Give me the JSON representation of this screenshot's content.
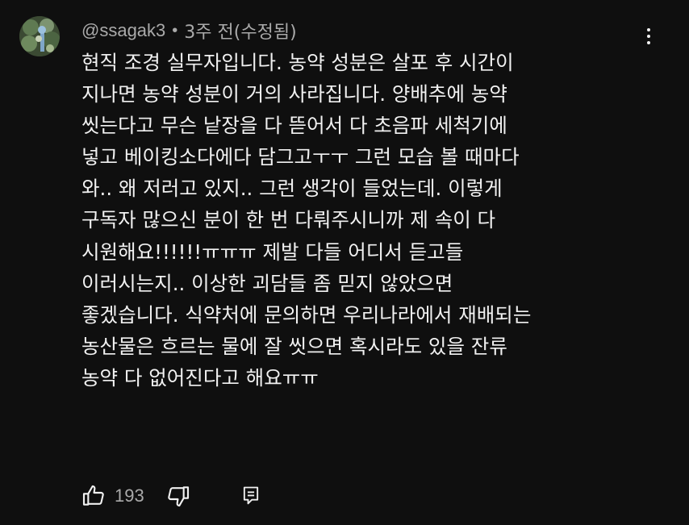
{
  "comment": {
    "author": "@ssagak3",
    "separator": "•",
    "time": "3주 전(수정됨)",
    "lines": [
      "현직 조경 실무자입니다. 농약 성분은 살포 후 시간이",
      "지나면 농약 성분이 거의 사라집니다. 양배추에 농약",
      "씻는다고 무슨 낱장을 다 뜯어서 다 초음파 세척기에",
      "넣고 베이킹소다에다 담그고ㅜㅜ 그런 모습 볼 때마다",
      "와.. 왜 저러고 있지.. 그런 생각이 들었는데. 이렇게",
      "구독자 많으신 분이 한 번 다뤄주시니까 제 속이 다",
      "시원해요!!!!!!ㅠㅠㅠ 제발 다들 어디서 듣고들",
      "이러시는지.. 이상한 괴담들 좀 믿지 않았으면",
      "좋겠습니다. 식약처에 문의하면 우리나라에서 재배되는",
      "농산물은 흐르는 물에 잘 씻으면  혹시라도 있을 잔류",
      "농약 다 없어진다고 해요ㅠㅠ"
    ],
    "like_count": "193"
  },
  "icons": {
    "like": "thumb-up-icon",
    "dislike": "thumb-down-icon",
    "reply": "reply-icon",
    "menu": "more-vertical-icon"
  },
  "colors": {
    "background": "#0f0f0f",
    "text": "#f1f1f1",
    "secondary_text": "#aaaaaa"
  }
}
